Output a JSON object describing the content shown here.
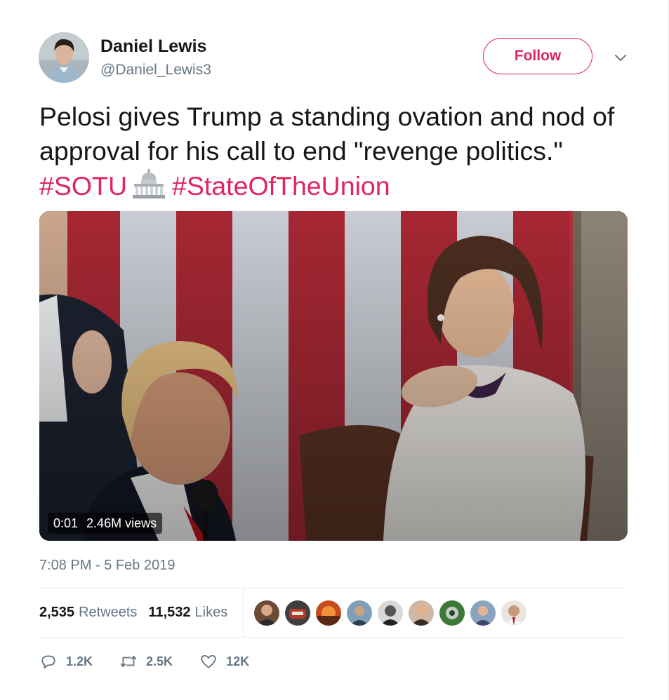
{
  "user": {
    "name": "Daniel Lewis",
    "handle": "@Daniel_Lewis3",
    "avatar_icon": "avatar"
  },
  "header": {
    "follow_label": "Follow",
    "menu_icon": "chevron-down-icon"
  },
  "tweet": {
    "text_part1": "Pelosi gives Trump a standing ovation and nod of approval for his call to end \"revenge politics.\" ",
    "hashtag1": "#SOTU",
    "emoji_icon": "classical-building-icon",
    "hashtag2": "#StateOfTheUnion"
  },
  "video": {
    "time": "0:01",
    "views": "2.46M views"
  },
  "timestamp": "7:08 PM - 5 Feb 2019",
  "stats": {
    "retweets_count": "2,535",
    "retweets_label": "Retweets",
    "likes_count": "11,532",
    "likes_label": "Likes"
  },
  "likers_count_shown": 9,
  "actions": {
    "reply_count": "1.2K",
    "retweet_count": "2.5K",
    "like_count": "12K"
  },
  "colors": {
    "accent": "#e0245e",
    "secondary_text": "#657786",
    "primary_text": "#14171a"
  }
}
